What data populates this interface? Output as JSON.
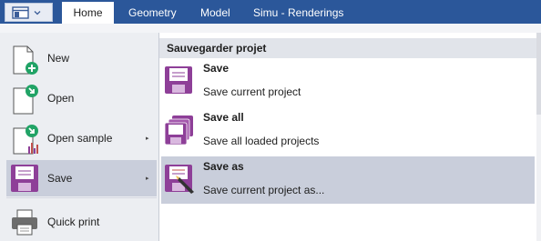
{
  "ribbon": {
    "tabs": [
      {
        "label": "Home"
      },
      {
        "label": "Geometry"
      },
      {
        "label": "Model"
      },
      {
        "label": "Simu - Renderings"
      }
    ]
  },
  "sidebar": {
    "items": [
      {
        "label": "New",
        "icon": "new-file-icon"
      },
      {
        "label": "Open",
        "icon": "open-file-icon"
      },
      {
        "label": "Open sample",
        "icon": "open-sample-icon",
        "has_submenu": true
      },
      {
        "label": "Save",
        "icon": "floppy-disk-icon",
        "has_submenu": true,
        "selected": true
      },
      {
        "label": "Quick print",
        "icon": "printer-icon"
      }
    ],
    "submenu_glyph": "▸"
  },
  "panel": {
    "title": "Sauvegarder projet",
    "options": [
      {
        "title": "Save",
        "description": "Save current project",
        "icon": "floppy-disk-icon"
      },
      {
        "title": "Save all",
        "description": "Save all loaded projects",
        "icon": "floppy-stack-icon"
      },
      {
        "title": "Save as",
        "description": "Save current project as...",
        "icon": "floppy-pen-icon",
        "selected": true
      }
    ]
  },
  "colors": {
    "ribbon": "#2b579a",
    "accent_purple": "#8e3f98",
    "selected_bg": "#c9cedb",
    "panel_header_bg": "#e1e4ea"
  }
}
